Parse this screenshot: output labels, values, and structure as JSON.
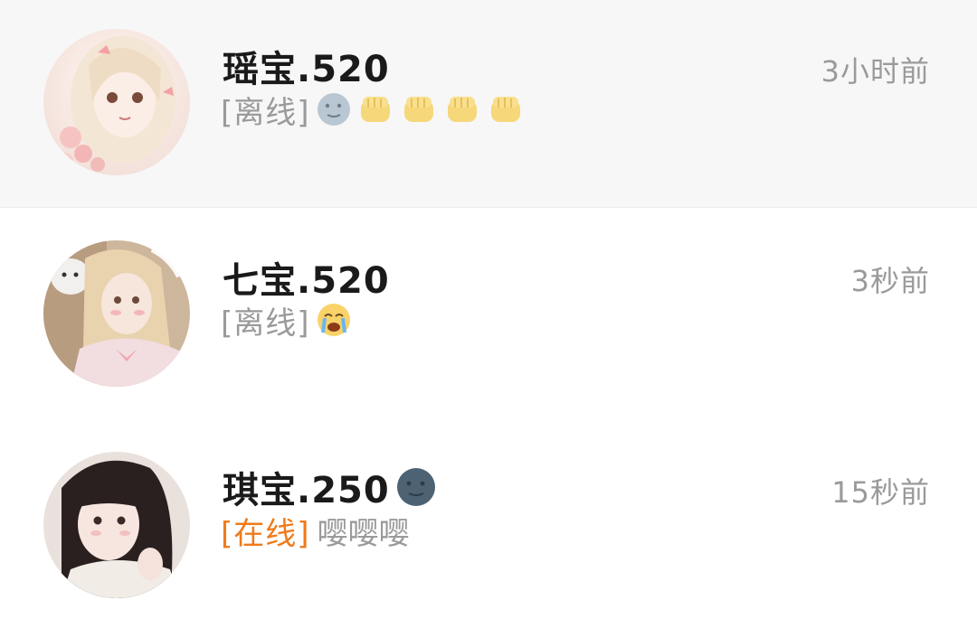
{
  "conversations": [
    {
      "name": "瑶宝.520",
      "status": "[离线]",
      "message_text": "",
      "message_emojis": [
        "full-moon-face",
        "fist",
        "fist",
        "fist",
        "fist"
      ],
      "time": "3小时前",
      "pinned": true,
      "avatar": "anime-girl-pink-bow-avatar"
    },
    {
      "name": "七宝.520",
      "status": "[离线]",
      "message_text": "",
      "message_emojis": [
        "crying-face"
      ],
      "time": "3秒前",
      "pinned": false,
      "avatar": "blonde-girl-photo-avatar"
    },
    {
      "name": "琪宝.250",
      "name_emoji": "new-moon-face",
      "status": "[在线]",
      "message_text": "嘤嘤嘤",
      "message_emojis": [],
      "time": "15秒前",
      "pinned": false,
      "avatar": "dark-hair-girl-photo-avatar"
    }
  ],
  "colors": {
    "pinned_background": "#f7f7f7",
    "online_status": "#f07a1a",
    "secondary_text": "#9a9a9a",
    "name_text": "#1a1a1a"
  }
}
